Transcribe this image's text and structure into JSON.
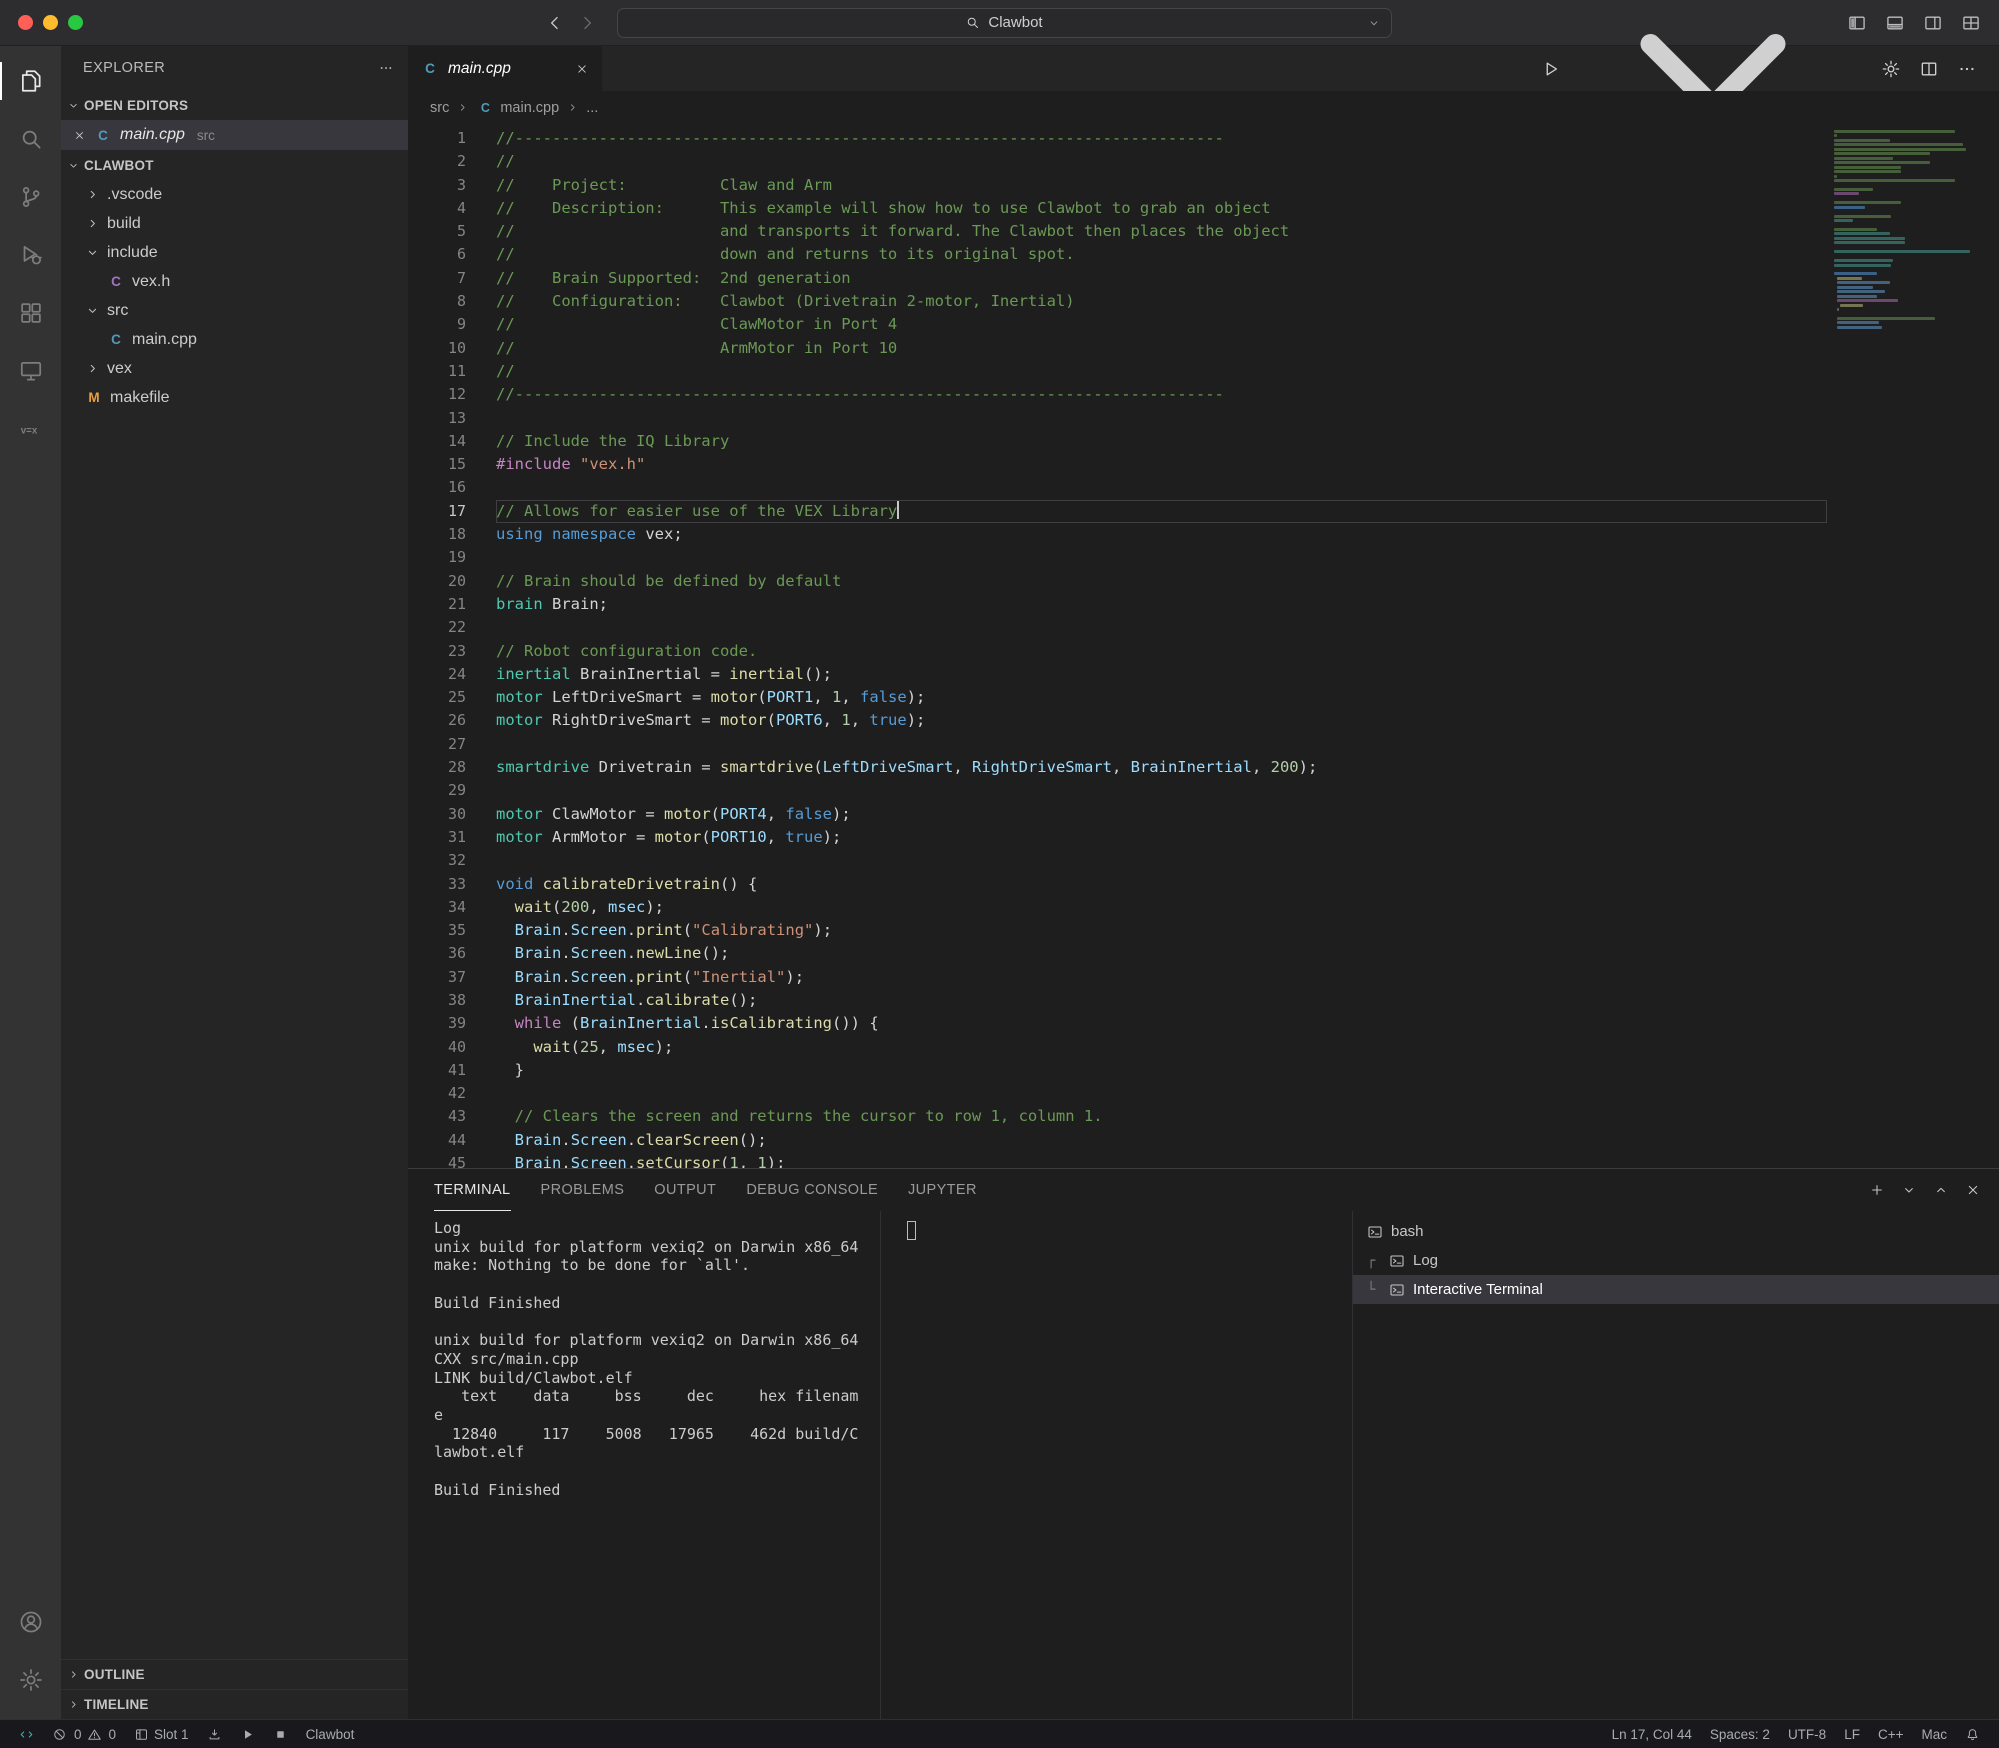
{
  "colors": {
    "traffic_lights": [
      "#ff5f57",
      "#febc2e",
      "#28c840"
    ],
    "selection_bg": "#37373d",
    "remote_indicator": "#3fb6b6",
    "active_tab_bg": "#1e1e1e"
  },
  "title_bar": {
    "command_center_value": "Clawbot",
    "layout_controls": [
      {
        "name": "toggle-primary-sidebar",
        "icon": "layoutL"
      },
      {
        "name": "toggle-panel",
        "icon": "layoutP"
      },
      {
        "name": "toggle-secondary-sidebar",
        "icon": "layoutR"
      },
      {
        "name": "customize-layout",
        "icon": "layoutG"
      }
    ]
  },
  "activity_bar": {
    "top": [
      {
        "name": "explorer",
        "icon": "files",
        "active": true
      },
      {
        "name": "search",
        "icon": "search"
      },
      {
        "name": "source-control",
        "icon": "scm"
      },
      {
        "name": "run-and-debug",
        "icon": "debug"
      },
      {
        "name": "extensions",
        "icon": "ext"
      },
      {
        "name": "remote-explorer",
        "icon": "remote"
      },
      {
        "name": "vex",
        "icon": "vex"
      }
    ],
    "bottom": [
      {
        "name": "accounts",
        "icon": "account"
      },
      {
        "name": "settings",
        "icon": "gear"
      }
    ]
  },
  "file_icons": {
    "cpp": {
      "glyph": "C",
      "color": "#519aba"
    },
    "h": {
      "glyph": "C",
      "color": "#a074c4"
    },
    "makefile": {
      "glyph": "M",
      "color": "#e8a03c"
    }
  },
  "sidebar": {
    "title": "EXPLORER",
    "sections": {
      "open_editors": {
        "label": "OPEN EDITORS",
        "items": [
          {
            "name": "main.cpp",
            "detail": "src",
            "icon": "cpp",
            "selected": true
          }
        ]
      },
      "workspace": {
        "label": "CLAWBOT"
      },
      "bottom": [
        {
          "label": "OUTLINE"
        },
        {
          "label": "TIMELINE"
        }
      ]
    },
    "tree": [
      {
        "label": ".vscode",
        "kind": "folder",
        "expanded": false,
        "level": 1
      },
      {
        "label": "build",
        "kind": "folder",
        "expanded": false,
        "level": 1
      },
      {
        "label": "include",
        "kind": "folder",
        "expanded": true,
        "level": 1
      },
      {
        "label": "vex.h",
        "kind": "file",
        "icon": "h",
        "level": 2
      },
      {
        "label": "src",
        "kind": "folder",
        "expanded": true,
        "level": 1
      },
      {
        "label": "main.cpp",
        "kind": "file",
        "icon": "cpp",
        "level": 2
      },
      {
        "label": "vex",
        "kind": "folder",
        "expanded": false,
        "level": 1
      },
      {
        "label": "makefile",
        "kind": "file",
        "icon": "makefile",
        "level": 1
      }
    ]
  },
  "editor": {
    "tab": {
      "label": "main.cpp",
      "icon": "cpp"
    },
    "breadcrumb": [
      {
        "label": "src"
      },
      {
        "label": "main.cpp",
        "icon": "cpp"
      },
      {
        "label": "..."
      }
    ],
    "actions": [
      {
        "name": "run-file",
        "icon": "run",
        "dropdown": true
      },
      {
        "name": "run-settings",
        "icon": "gear"
      },
      {
        "name": "split-editor",
        "icon": "split"
      },
      {
        "name": "more-actions",
        "icon": "more"
      }
    ],
    "lines": [
      {
        "n": 1,
        "t": [
          [
            "c",
            "//----------------------------------------------------------------------------"
          ]
        ]
      },
      {
        "n": 2,
        "t": [
          [
            "c",
            "//"
          ]
        ]
      },
      {
        "n": 3,
        "t": [
          [
            "c",
            "//    Project:          Claw and Arm"
          ]
        ]
      },
      {
        "n": 4,
        "t": [
          [
            "c",
            "//    Description:      This example will show how to use Clawbot to grab an object"
          ]
        ]
      },
      {
        "n": 5,
        "t": [
          [
            "c",
            "//                      and transports it forward. The Clawbot then places the object"
          ]
        ]
      },
      {
        "n": 6,
        "t": [
          [
            "c",
            "//                      down and returns to its original spot."
          ]
        ]
      },
      {
        "n": 7,
        "t": [
          [
            "c",
            "//    Brain Supported:  2nd generation"
          ]
        ]
      },
      {
        "n": 8,
        "t": [
          [
            "c",
            "//    Configuration:    Clawbot (Drivetrain 2-motor, Inertial)"
          ]
        ]
      },
      {
        "n": 9,
        "t": [
          [
            "c",
            "//                      ClawMotor in Port 4"
          ]
        ]
      },
      {
        "n": 10,
        "t": [
          [
            "c",
            "//                      ArmMotor in Port 10"
          ]
        ]
      },
      {
        "n": 11,
        "t": [
          [
            "c",
            "//"
          ]
        ]
      },
      {
        "n": 12,
        "t": [
          [
            "c",
            "//----------------------------------------------------------------------------"
          ]
        ]
      },
      {
        "n": 13,
        "t": []
      },
      {
        "n": 14,
        "t": [
          [
            "c",
            "// Include the IQ Library"
          ]
        ]
      },
      {
        "n": 15,
        "t": [
          [
            "d",
            "#include"
          ],
          [
            "p",
            " "
          ],
          [
            "s",
            "\"vex.h\""
          ]
        ]
      },
      {
        "n": 16,
        "t": []
      },
      {
        "n": 17,
        "cur": true,
        "caret": true,
        "t": [
          [
            "c",
            "// Allows for easier use of the VEX Library"
          ]
        ]
      },
      {
        "n": 18,
        "t": [
          [
            "k",
            "using"
          ],
          [
            "p",
            " "
          ],
          [
            "k",
            "namespace"
          ],
          [
            "p",
            " vex;"
          ]
        ]
      },
      {
        "n": 19,
        "t": []
      },
      {
        "n": 20,
        "t": [
          [
            "c",
            "// Brain should be defined by default"
          ]
        ]
      },
      {
        "n": 21,
        "t": [
          [
            "t",
            "brain"
          ],
          [
            "p",
            " Brain;"
          ]
        ]
      },
      {
        "n": 22,
        "t": []
      },
      {
        "n": 23,
        "t": [
          [
            "c",
            "// Robot configuration code."
          ]
        ]
      },
      {
        "n": 24,
        "t": [
          [
            "t",
            "inertial"
          ],
          [
            "p",
            " BrainInertial = "
          ],
          [
            "f",
            "inertial"
          ],
          [
            "p",
            "();"
          ]
        ]
      },
      {
        "n": 25,
        "t": [
          [
            "t",
            "motor"
          ],
          [
            "p",
            " LeftDriveSmart = "
          ],
          [
            "f",
            "motor"
          ],
          [
            "p",
            "("
          ],
          [
            "v",
            "PORT1"
          ],
          [
            "p",
            ", "
          ],
          [
            "m",
            "1"
          ],
          [
            "p",
            ", "
          ],
          [
            "k",
            "false"
          ],
          [
            "p",
            ");"
          ]
        ]
      },
      {
        "n": 26,
        "t": [
          [
            "t",
            "motor"
          ],
          [
            "p",
            " RightDriveSmart = "
          ],
          [
            "f",
            "motor"
          ],
          [
            "p",
            "("
          ],
          [
            "v",
            "PORT6"
          ],
          [
            "p",
            ", "
          ],
          [
            "m",
            "1"
          ],
          [
            "p",
            ", "
          ],
          [
            "k",
            "true"
          ],
          [
            "p",
            ");"
          ]
        ]
      },
      {
        "n": 27,
        "t": []
      },
      {
        "n": 28,
        "t": [
          [
            "t",
            "smartdrive"
          ],
          [
            "p",
            " Drivetrain = "
          ],
          [
            "f",
            "smartdrive"
          ],
          [
            "p",
            "("
          ],
          [
            "v",
            "LeftDriveSmart"
          ],
          [
            "p",
            ", "
          ],
          [
            "v",
            "RightDriveSmart"
          ],
          [
            "p",
            ", "
          ],
          [
            "v",
            "BrainInertial"
          ],
          [
            "p",
            ", "
          ],
          [
            "m",
            "200"
          ],
          [
            "p",
            ");"
          ]
        ]
      },
      {
        "n": 29,
        "t": []
      },
      {
        "n": 30,
        "t": [
          [
            "t",
            "motor"
          ],
          [
            "p",
            " ClawMotor = "
          ],
          [
            "f",
            "motor"
          ],
          [
            "p",
            "("
          ],
          [
            "v",
            "PORT4"
          ],
          [
            "p",
            ", "
          ],
          [
            "k",
            "false"
          ],
          [
            "p",
            ");"
          ]
        ]
      },
      {
        "n": 31,
        "t": [
          [
            "t",
            "motor"
          ],
          [
            "p",
            " ArmMotor = "
          ],
          [
            "f",
            "motor"
          ],
          [
            "p",
            "("
          ],
          [
            "v",
            "PORT10"
          ],
          [
            "p",
            ", "
          ],
          [
            "k",
            "true"
          ],
          [
            "p",
            ");"
          ]
        ]
      },
      {
        "n": 32,
        "t": []
      },
      {
        "n": 33,
        "t": [
          [
            "k",
            "void"
          ],
          [
            "p",
            " "
          ],
          [
            "f",
            "calibrateDrivetrain"
          ],
          [
            "p",
            "() {"
          ]
        ]
      },
      {
        "n": 34,
        "t": [
          [
            "p",
            "  "
          ],
          [
            "f",
            "wait"
          ],
          [
            "p",
            "("
          ],
          [
            "m",
            "200"
          ],
          [
            "p",
            ", "
          ],
          [
            "v",
            "msec"
          ],
          [
            "p",
            ");"
          ]
        ]
      },
      {
        "n": 35,
        "t": [
          [
            "p",
            "  "
          ],
          [
            "v",
            "Brain"
          ],
          [
            "p",
            "."
          ],
          [
            "v",
            "Screen"
          ],
          [
            "p",
            "."
          ],
          [
            "f",
            "print"
          ],
          [
            "p",
            "("
          ],
          [
            "s",
            "\"Calibrating\""
          ],
          [
            "p",
            ");"
          ]
        ]
      },
      {
        "n": 36,
        "t": [
          [
            "p",
            "  "
          ],
          [
            "v",
            "Brain"
          ],
          [
            "p",
            "."
          ],
          [
            "v",
            "Screen"
          ],
          [
            "p",
            "."
          ],
          [
            "f",
            "newLine"
          ],
          [
            "p",
            "();"
          ]
        ]
      },
      {
        "n": 37,
        "t": [
          [
            "p",
            "  "
          ],
          [
            "v",
            "Brain"
          ],
          [
            "p",
            "."
          ],
          [
            "v",
            "Screen"
          ],
          [
            "p",
            "."
          ],
          [
            "f",
            "print"
          ],
          [
            "p",
            "("
          ],
          [
            "s",
            "\"Inertial\""
          ],
          [
            "p",
            ");"
          ]
        ]
      },
      {
        "n": 38,
        "t": [
          [
            "p",
            "  "
          ],
          [
            "v",
            "BrainInertial"
          ],
          [
            "p",
            "."
          ],
          [
            "f",
            "calibrate"
          ],
          [
            "p",
            "();"
          ]
        ]
      },
      {
        "n": 39,
        "t": [
          [
            "p",
            "  "
          ],
          [
            "q",
            "while"
          ],
          [
            "p",
            " ("
          ],
          [
            "v",
            "BrainInertial"
          ],
          [
            "p",
            "."
          ],
          [
            "f",
            "isCalibrating"
          ],
          [
            "p",
            "()) {"
          ]
        ]
      },
      {
        "n": 40,
        "t": [
          [
            "p",
            "    "
          ],
          [
            "f",
            "wait"
          ],
          [
            "p",
            "("
          ],
          [
            "m",
            "25"
          ],
          [
            "p",
            ", "
          ],
          [
            "v",
            "msec"
          ],
          [
            "p",
            ");"
          ]
        ]
      },
      {
        "n": 41,
        "t": [
          [
            "p",
            "  }"
          ]
        ]
      },
      {
        "n": 42,
        "t": []
      },
      {
        "n": 43,
        "t": [
          [
            "p",
            "  "
          ],
          [
            "c",
            "// Clears the screen and returns the cursor to row 1, column 1."
          ]
        ]
      },
      {
        "n": 44,
        "t": [
          [
            "p",
            "  "
          ],
          [
            "v",
            "Brain"
          ],
          [
            "p",
            "."
          ],
          [
            "v",
            "Screen"
          ],
          [
            "p",
            "."
          ],
          [
            "f",
            "clearScreen"
          ],
          [
            "p",
            "();"
          ]
        ]
      },
      {
        "n": 45,
        "t": [
          [
            "p",
            "  "
          ],
          [
            "v",
            "Brain"
          ],
          [
            "p",
            "."
          ],
          [
            "v",
            "Screen"
          ],
          [
            "p",
            "."
          ],
          [
            "f",
            "setCursor"
          ],
          [
            "p",
            "("
          ],
          [
            "m",
            "1"
          ],
          [
            "p",
            ", "
          ],
          [
            "m",
            "1"
          ],
          [
            "p",
            ");"
          ]
        ]
      }
    ]
  },
  "panel": {
    "tabs": [
      {
        "label": "TERMINAL",
        "active": true
      },
      {
        "label": "PROBLEMS"
      },
      {
        "label": "OUTPUT"
      },
      {
        "label": "DEBUG CONSOLE"
      },
      {
        "label": "JUPYTER"
      }
    ],
    "actions": [
      {
        "name": "new-terminal",
        "icon": "plus"
      },
      {
        "name": "launch-profile-dropdown",
        "icon": "chevD"
      },
      {
        "name": "maximize-panel",
        "icon": "chevU"
      },
      {
        "name": "close-panel",
        "icon": "close"
      }
    ],
    "output_lines": [
      "Log",
      "unix build for platform vexiq2 on Darwin x86_64",
      "make: Nothing to be done for `all'.",
      "",
      "Build Finished",
      "",
      "unix build for platform vexiq2 on Darwin x86_64",
      "CXX src/main.cpp",
      "LINK build/Clawbot.elf",
      "   text    data     bss     dec     hex filenam",
      "e",
      "  12840     117    5008   17965    462d build/C",
      "lawbot.elf",
      "",
      "Build Finished"
    ],
    "terminals": [
      {
        "label": "bash",
        "connector": ""
      },
      {
        "label": "Log",
        "connector": "┌"
      },
      {
        "label": "Interactive Terminal",
        "connector": "└",
        "sel": true
      }
    ]
  },
  "status_bar": {
    "left": [
      {
        "icon": "remoteInd",
        "name": "remote-indicator",
        "color": "#3fb6b6"
      },
      {
        "problems": true,
        "error_count": "0",
        "warning_count": "0",
        "name": "problems"
      },
      {
        "icon": "slot",
        "text": "Slot 1",
        "name": "vex-slot"
      },
      {
        "icon": "download",
        "name": "vex-download"
      },
      {
        "icon": "play",
        "name": "vex-play"
      },
      {
        "icon": "stop",
        "name": "vex-stop"
      },
      {
        "text": "Clawbot",
        "name": "vex-project"
      }
    ],
    "right": [
      {
        "text": "Ln 17, Col 44",
        "name": "cursor-position"
      },
      {
        "text": "Spaces: 2",
        "name": "indentation"
      },
      {
        "text": "UTF-8",
        "name": "encoding"
      },
      {
        "text": "LF",
        "name": "eol"
      },
      {
        "text": "C++",
        "name": "language-mode"
      },
      {
        "text": "Mac",
        "name": "keymap"
      },
      {
        "icon": "bell",
        "name": "notifications-bell"
      }
    ]
  }
}
